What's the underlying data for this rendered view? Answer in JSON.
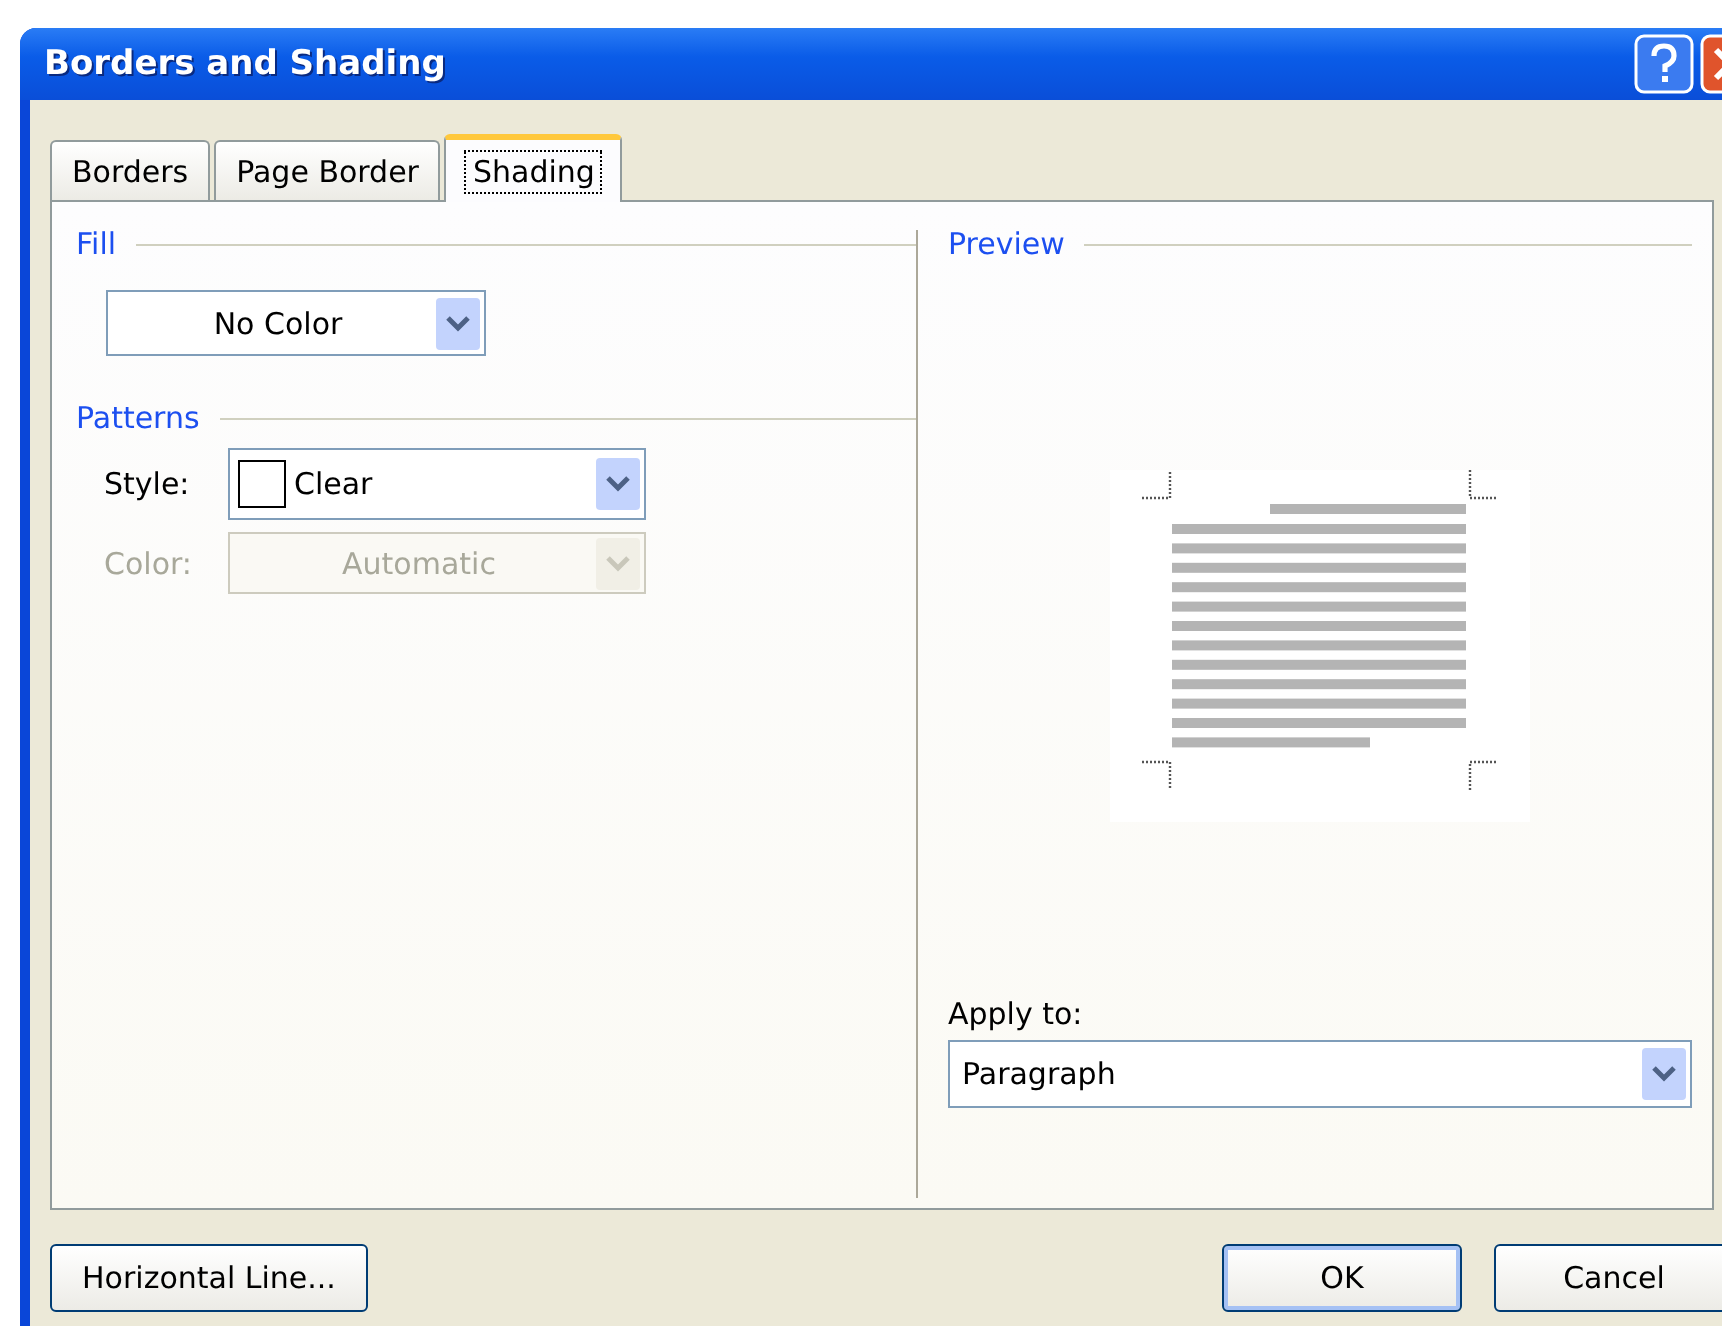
{
  "window": {
    "title": "Borders and Shading"
  },
  "tabs": [
    {
      "label": "Borders",
      "selected": false
    },
    {
      "label": "Page Border",
      "selected": false
    },
    {
      "label": "Shading",
      "selected": true
    }
  ],
  "fill": {
    "heading": "Fill",
    "value": "No Color"
  },
  "patterns": {
    "heading": "Patterns",
    "fields": [
      {
        "label": "Style:",
        "value": "Clear",
        "swatch": true,
        "disabled": false
      },
      {
        "label": "Color:",
        "value": "Automatic",
        "swatch": false,
        "disabled": true
      }
    ]
  },
  "preview": {
    "heading": "Preview",
    "apply_to_label": "Apply to:",
    "apply_to_value": "Paragraph"
  },
  "buttons": [
    {
      "label": "Horizontal Line...",
      "kind": "left",
      "default": false
    },
    {
      "label": "OK",
      "kind": "right",
      "default": true
    },
    {
      "label": "Cancel",
      "kind": "right",
      "default": false
    }
  ]
}
